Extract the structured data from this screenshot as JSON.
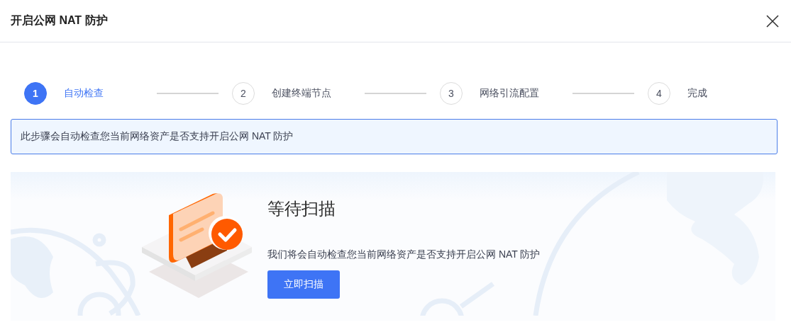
{
  "dialog": {
    "title": "开启公网 NAT 防护"
  },
  "steps": [
    {
      "number": "1",
      "label": "自动检查",
      "selected": true
    },
    {
      "number": "2",
      "label": "创建终端节点",
      "selected": false
    },
    {
      "number": "3",
      "label": "网络引流配置",
      "selected": false
    },
    {
      "number": "4",
      "label": "完成",
      "selected": false
    }
  ],
  "notice": "此步骤会自动检查您当前网络资产是否支持开启公网 NAT 防护",
  "scan": {
    "title": "等待扫描",
    "description": "我们将会自动检查您当前网络资产是否支持开启公网 NAT 防护",
    "button": "立即扫描"
  }
}
